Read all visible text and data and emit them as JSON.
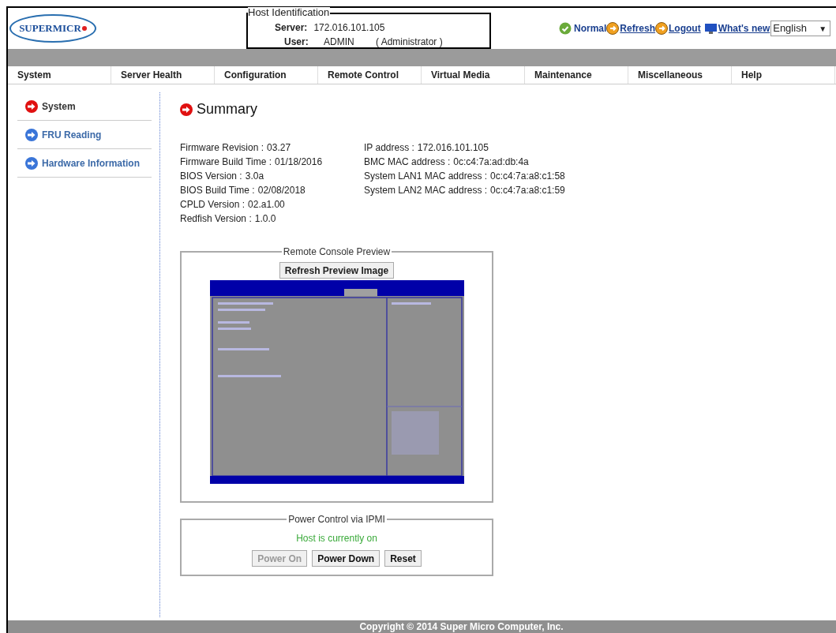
{
  "header": {
    "logo": "SUPERMICR",
    "host_identification": {
      "legend": "Host Identification",
      "server_label": "Server:",
      "server": "172.016.101.105",
      "user_label": "User:",
      "user": "ADMIN",
      "role": "( Administrator )"
    },
    "status": "Normal",
    "links": [
      "Refresh",
      "Logout",
      "What's new"
    ],
    "language": "English",
    "language_arrow": "▼"
  },
  "menu": [
    {
      "label": "System"
    },
    {
      "label": "Server Health"
    },
    {
      "label": "Configuration"
    },
    {
      "label": "Remote Control"
    },
    {
      "label": "Virtual Media"
    },
    {
      "label": "Maintenance"
    },
    {
      "label": "Miscellaneous"
    },
    {
      "label": "Help"
    }
  ],
  "sidebar": {
    "items": [
      {
        "label": "System",
        "selected": true
      },
      {
        "label": "FRU Reading",
        "selected": false
      },
      {
        "label": "Hardware Information",
        "selected": false
      }
    ]
  },
  "summary": {
    "title": "Summary",
    "left": [
      {
        "label": "Firmware Revision :",
        "value": "03.27"
      },
      {
        "label": "Firmware Build Time :",
        "value": "01/18/2016"
      },
      {
        "label": "BIOS Version :",
        "value": "3.0a"
      },
      {
        "label": "BIOS Build Time :",
        "value": "02/08/2018"
      },
      {
        "label": "CPLD Version :",
        "value": "02.a1.00"
      },
      {
        "label": "Redfish Version :",
        "value": "1.0.0"
      }
    ],
    "right": [
      {
        "label": "IP address :",
        "value": "172.016.101.105"
      },
      {
        "label": "BMC MAC address :",
        "value": "0c:c4:7a:ad:db:4a"
      },
      {
        "label": "System LAN1 MAC address :",
        "value": "0c:c4:7a:a8:c1:58"
      },
      {
        "label": "System LAN2 MAC address :",
        "value": "0c:c4:7a:a8:c1:59"
      }
    ]
  },
  "preview": {
    "legend": "Remote Console Preview",
    "button": "Refresh Preview Image"
  },
  "power": {
    "legend": "Power Control via IPMI",
    "status": "Host is currently on",
    "buttons": [
      {
        "label": "Power On",
        "disabled": true
      },
      {
        "label": "Power Down",
        "disabled": false
      },
      {
        "label": "Reset",
        "disabled": false
      }
    ]
  },
  "footer": "Copyright © 2014 Super Micro Computer, Inc."
}
